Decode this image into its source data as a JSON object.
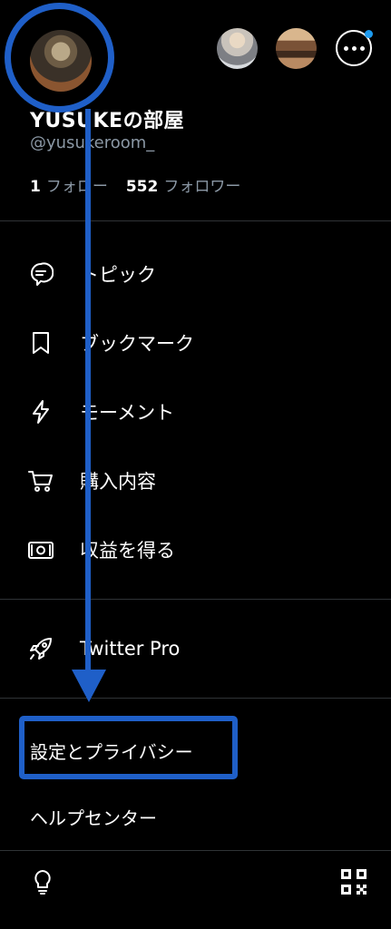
{
  "profile": {
    "display_name": "YUSUKEの部屋",
    "handle": "@yusukeroom_",
    "following_count": "1",
    "following_label": "フォロー",
    "followers_count": "552",
    "followers_label": "フォロワー"
  },
  "menu": {
    "items": [
      {
        "label": "トピック",
        "icon": "topic-icon"
      },
      {
        "label": "ブックマーク",
        "icon": "bookmark-icon"
      },
      {
        "label": "モーメント",
        "icon": "bolt-icon"
      },
      {
        "label": "購入内容",
        "icon": "cart-icon"
      },
      {
        "label": "収益を得る",
        "icon": "money-icon"
      },
      {
        "label": "Twitter Pro",
        "icon": "rocket-icon"
      }
    ],
    "settings_label": "設定とプライバシー",
    "help_label": "ヘルプセンター"
  },
  "bottom": {
    "left_icon": "lightbulb-icon",
    "right_icon": "qr-code-icon"
  },
  "colors": {
    "background": "#000000",
    "accent": "#1d9bf0",
    "annotation": "#1f5fc8",
    "muted": "#8b98a5"
  }
}
